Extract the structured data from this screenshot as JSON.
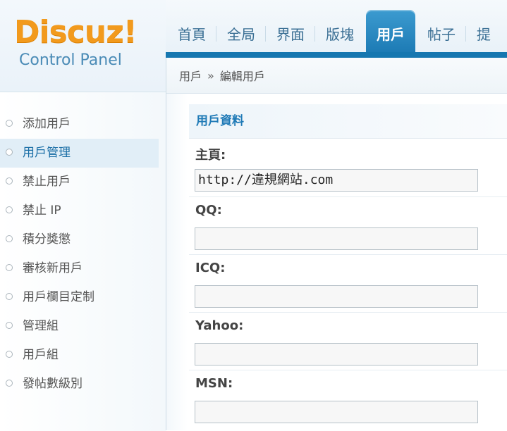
{
  "logo": {
    "main": "Discuz!",
    "sub": "Control Panel"
  },
  "nav": {
    "items": [
      {
        "label": "首頁",
        "active": false
      },
      {
        "label": "全局",
        "active": false
      },
      {
        "label": "界面",
        "active": false
      },
      {
        "label": "版塊",
        "active": false
      },
      {
        "label": "用戶",
        "active": true
      },
      {
        "label": "帖子",
        "active": false
      },
      {
        "label": "提",
        "active": false
      }
    ]
  },
  "breadcrumb": {
    "parent": "用戶",
    "separator": "»",
    "current": "編輯用戶"
  },
  "sidebar": {
    "items": [
      {
        "label": "添加用戶"
      },
      {
        "label": "用戶管理"
      },
      {
        "label": "禁止用戶"
      },
      {
        "label": "禁止 IP"
      },
      {
        "label": "積分獎懲"
      },
      {
        "label": "審核新用戶"
      },
      {
        "label": "用戶欄目定制"
      },
      {
        "label": "管理組"
      },
      {
        "label": "用戶組"
      },
      {
        "label": "發帖數級別"
      }
    ],
    "active_index": 1
  },
  "form": {
    "section_title": "用戶資料",
    "fields": [
      {
        "label": "主頁:",
        "value": "http://違規網站.com"
      },
      {
        "label": "QQ:",
        "value": ""
      },
      {
        "label": "ICQ:",
        "value": ""
      },
      {
        "label": "Yahoo:",
        "value": ""
      },
      {
        "label": "MSN:",
        "value": ""
      }
    ]
  },
  "colors": {
    "brand_orange": "#f29a1d",
    "accent_blue": "#1677b0",
    "link_blue": "#1f7ab6"
  }
}
